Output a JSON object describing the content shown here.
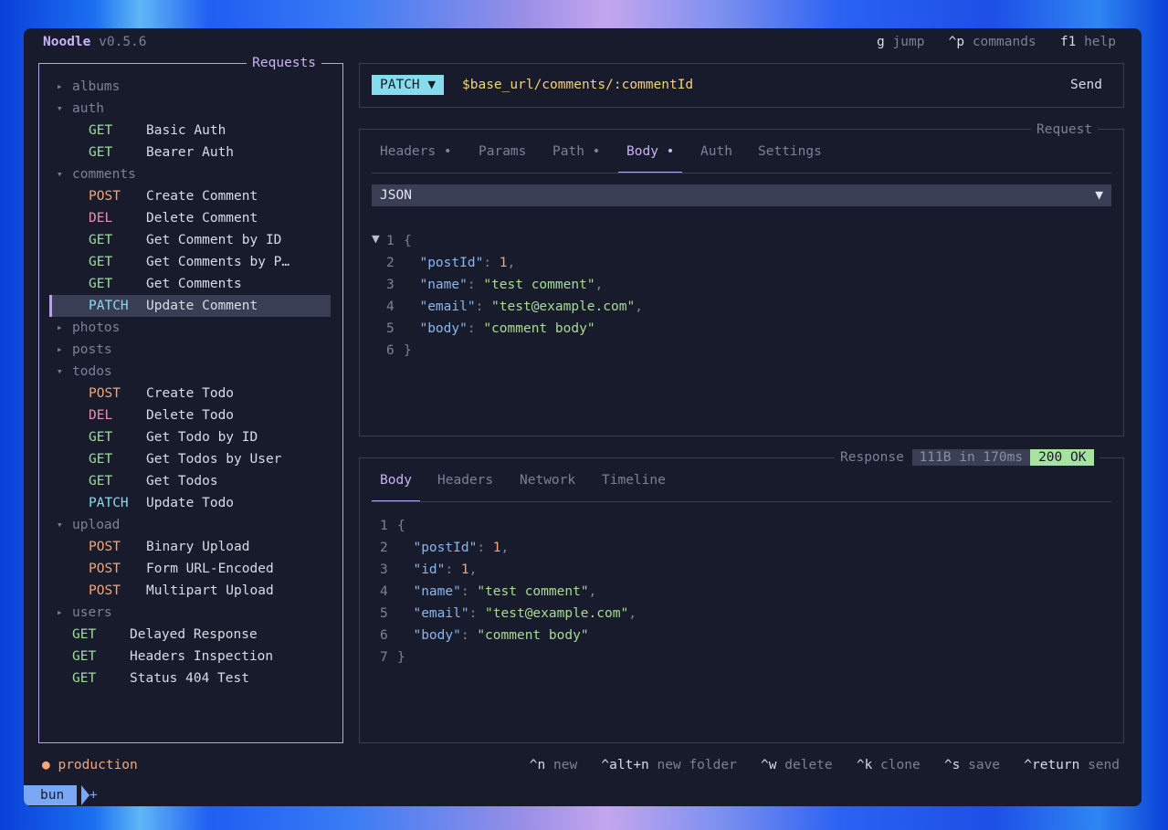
{
  "app": {
    "name": "Noodle",
    "version": "v0.5.6"
  },
  "top_shortcuts": [
    {
      "key": "g",
      "label": "jump"
    },
    {
      "key": "^p",
      "label": "commands"
    },
    {
      "key": "f1",
      "label": "help"
    }
  ],
  "sidebar": {
    "title": "Requests",
    "tree": [
      {
        "type": "folder",
        "name": "albums",
        "expanded": false
      },
      {
        "type": "folder",
        "name": "auth",
        "expanded": true
      },
      {
        "type": "request",
        "method": "GET",
        "name": "Basic Auth"
      },
      {
        "type": "request",
        "method": "GET",
        "name": "Bearer Auth"
      },
      {
        "type": "folder",
        "name": "comments",
        "expanded": true
      },
      {
        "type": "request",
        "method": "POST",
        "name": "Create Comment"
      },
      {
        "type": "request",
        "method": "DEL",
        "name": "Delete Comment"
      },
      {
        "type": "request",
        "method": "GET",
        "name": "Get Comment by ID"
      },
      {
        "type": "request",
        "method": "GET",
        "name": "Get Comments by P…"
      },
      {
        "type": "request",
        "method": "GET",
        "name": "Get Comments"
      },
      {
        "type": "request",
        "method": "PATCH",
        "name": "Update Comment",
        "selected": true
      },
      {
        "type": "folder",
        "name": "photos",
        "expanded": false
      },
      {
        "type": "folder",
        "name": "posts",
        "expanded": false
      },
      {
        "type": "folder",
        "name": "todos",
        "expanded": true
      },
      {
        "type": "request",
        "method": "POST",
        "name": "Create Todo"
      },
      {
        "type": "request",
        "method": "DEL",
        "name": "Delete Todo"
      },
      {
        "type": "request",
        "method": "GET",
        "name": "Get Todo by ID"
      },
      {
        "type": "request",
        "method": "GET",
        "name": "Get Todos by User"
      },
      {
        "type": "request",
        "method": "GET",
        "name": "Get Todos"
      },
      {
        "type": "request",
        "method": "PATCH",
        "name": "Update Todo"
      },
      {
        "type": "folder",
        "name": "upload",
        "expanded": true
      },
      {
        "type": "request",
        "method": "POST",
        "name": "Binary Upload"
      },
      {
        "type": "request",
        "method": "POST",
        "name": "Form URL-Encoded"
      },
      {
        "type": "request",
        "method": "POST",
        "name": "Multipart Upload"
      },
      {
        "type": "folder",
        "name": "users",
        "expanded": false
      },
      {
        "type": "root-request",
        "method": "GET",
        "name": "Delayed Response"
      },
      {
        "type": "root-request",
        "method": "GET",
        "name": "Headers Inspection"
      },
      {
        "type": "root-request",
        "method": "GET",
        "name": "Status 404 Test"
      }
    ]
  },
  "url_bar": {
    "method": "PATCH",
    "method_arrow": "▼",
    "url": "$base_url/comments/:commentId",
    "send": "Send"
  },
  "request": {
    "title": "Request",
    "tabs": [
      {
        "label": "Headers",
        "dot": "•",
        "active": false
      },
      {
        "label": "Params",
        "dot": "",
        "active": false
      },
      {
        "label": "Path",
        "dot": "•",
        "active": false
      },
      {
        "label": "Body",
        "dot": "•",
        "active": true
      },
      {
        "label": "Auth",
        "dot": "",
        "active": false
      },
      {
        "label": "Settings",
        "dot": "",
        "active": false
      }
    ],
    "body_type": "JSON",
    "body_type_arrow": "▼",
    "fold_marker": "▼",
    "lines": [
      {
        "n": "1",
        "indent": "",
        "k": "",
        "v": "",
        "vt": "",
        "c": "",
        "raw": "{"
      },
      {
        "n": "2",
        "indent": "  ",
        "k": "\"postId\"",
        "v": "1",
        "vt": "num",
        "c": ","
      },
      {
        "n": "3",
        "indent": "  ",
        "k": "\"name\"",
        "v": "\"test comment\"",
        "vt": "str",
        "c": ","
      },
      {
        "n": "4",
        "indent": "  ",
        "k": "\"email\"",
        "v": "\"test@example.com\"",
        "vt": "str",
        "c": ","
      },
      {
        "n": "5",
        "indent": "  ",
        "k": "\"body\"",
        "v": "\"comment body\"",
        "vt": "str",
        "c": ""
      },
      {
        "n": "6",
        "indent": "",
        "k": "",
        "v": "",
        "vt": "",
        "c": "",
        "raw": "}"
      }
    ]
  },
  "response": {
    "title": "Response",
    "size_time": "111B in 170ms",
    "status": "200 OK",
    "tabs": [
      {
        "label": "Body",
        "active": true
      },
      {
        "label": "Headers",
        "active": false
      },
      {
        "label": "Network",
        "active": false
      },
      {
        "label": "Timeline",
        "active": false
      }
    ],
    "lines": [
      {
        "n": "1",
        "indent": "",
        "k": "",
        "v": "",
        "vt": "",
        "c": "",
        "raw": "{"
      },
      {
        "n": "2",
        "indent": "  ",
        "k": "\"postId\"",
        "v": "1",
        "vt": "num",
        "c": ","
      },
      {
        "n": "3",
        "indent": "  ",
        "k": "\"id\"",
        "v": "1",
        "vt": "num",
        "c": ","
      },
      {
        "n": "4",
        "indent": "  ",
        "k": "\"name\"",
        "v": "\"test comment\"",
        "vt": "str",
        "c": ","
      },
      {
        "n": "5",
        "indent": "  ",
        "k": "\"email\"",
        "v": "\"test@example.com\"",
        "vt": "str",
        "c": ","
      },
      {
        "n": "6",
        "indent": "  ",
        "k": "\"body\"",
        "v": "\"comment body\"",
        "vt": "str",
        "c": ""
      },
      {
        "n": "7",
        "indent": "",
        "k": "",
        "v": "",
        "vt": "",
        "c": "",
        "raw": "}"
      }
    ]
  },
  "footer": {
    "environment": "production",
    "env_color": "#f3a679",
    "shortcuts": [
      {
        "key": "^n",
        "label": "new"
      },
      {
        "key": "^alt+n",
        "label": "new folder"
      },
      {
        "key": "^w",
        "label": "delete"
      },
      {
        "key": "^k",
        "label": "clone"
      },
      {
        "key": "^s",
        "label": "save"
      },
      {
        "key": "^return",
        "label": "send"
      }
    ]
  },
  "tmux": {
    "session": "bun",
    "add": "+"
  },
  "colors": {
    "GET": "#9fdc9a",
    "POST": "#f3a679",
    "DEL": "#ec8fb0",
    "PATCH": "#86dced",
    "accent": "#b9a3ef",
    "ok": "#a6e3a1"
  }
}
